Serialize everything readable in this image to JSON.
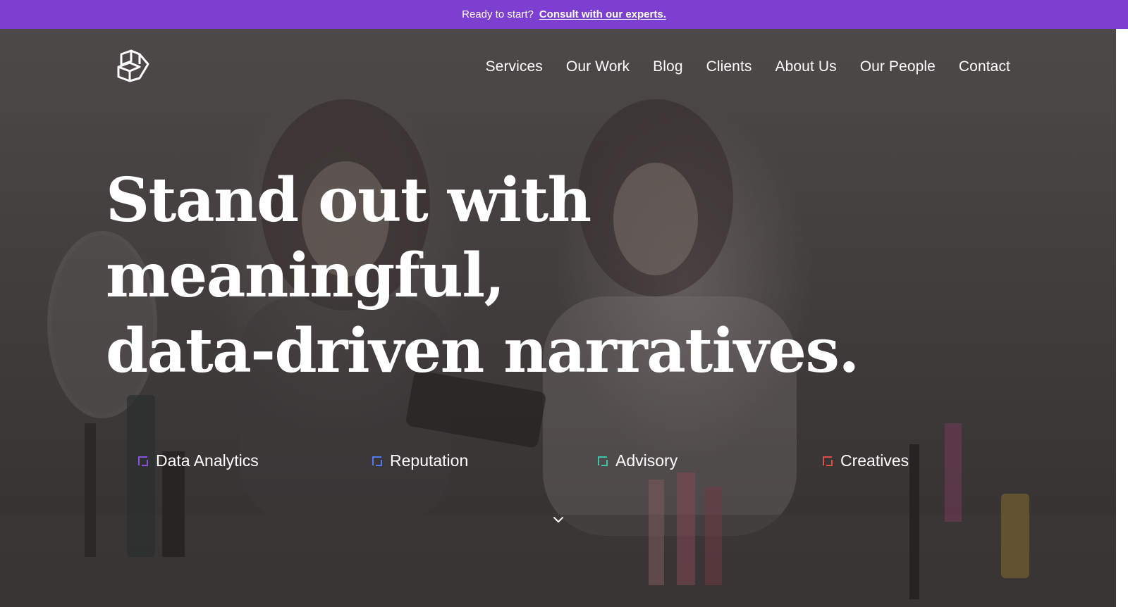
{
  "announcement": {
    "prompt": "Ready to start?",
    "link_label": "Consult with our experts."
  },
  "header": {
    "logo_icon": "stacked-boxes-logo-icon",
    "nav": [
      {
        "label": "Services"
      },
      {
        "label": "Our Work"
      },
      {
        "label": "Blog"
      },
      {
        "label": "Clients"
      },
      {
        "label": "About Us"
      },
      {
        "label": "Our People"
      },
      {
        "label": "Contact"
      }
    ]
  },
  "hero": {
    "headline_lines": [
      "Stand out with",
      "meaningful,",
      "data-driven narratives."
    ]
  },
  "services": [
    {
      "label": "Data Analytics",
      "icon": "square-bracket-icon",
      "color": "#8b4fe0"
    },
    {
      "label": "Reputation",
      "icon": "square-bracket-icon",
      "color": "#4d7ef0"
    },
    {
      "label": "Advisory",
      "icon": "square-bracket-icon",
      "color": "#3ec4a8"
    },
    {
      "label": "Creatives",
      "icon": "square-bracket-icon",
      "color": "#e04b4b"
    }
  ],
  "scroll_icon": "chevron-down-icon",
  "colors": {
    "accent": "#7c3fcf",
    "text": "#ffffff"
  }
}
